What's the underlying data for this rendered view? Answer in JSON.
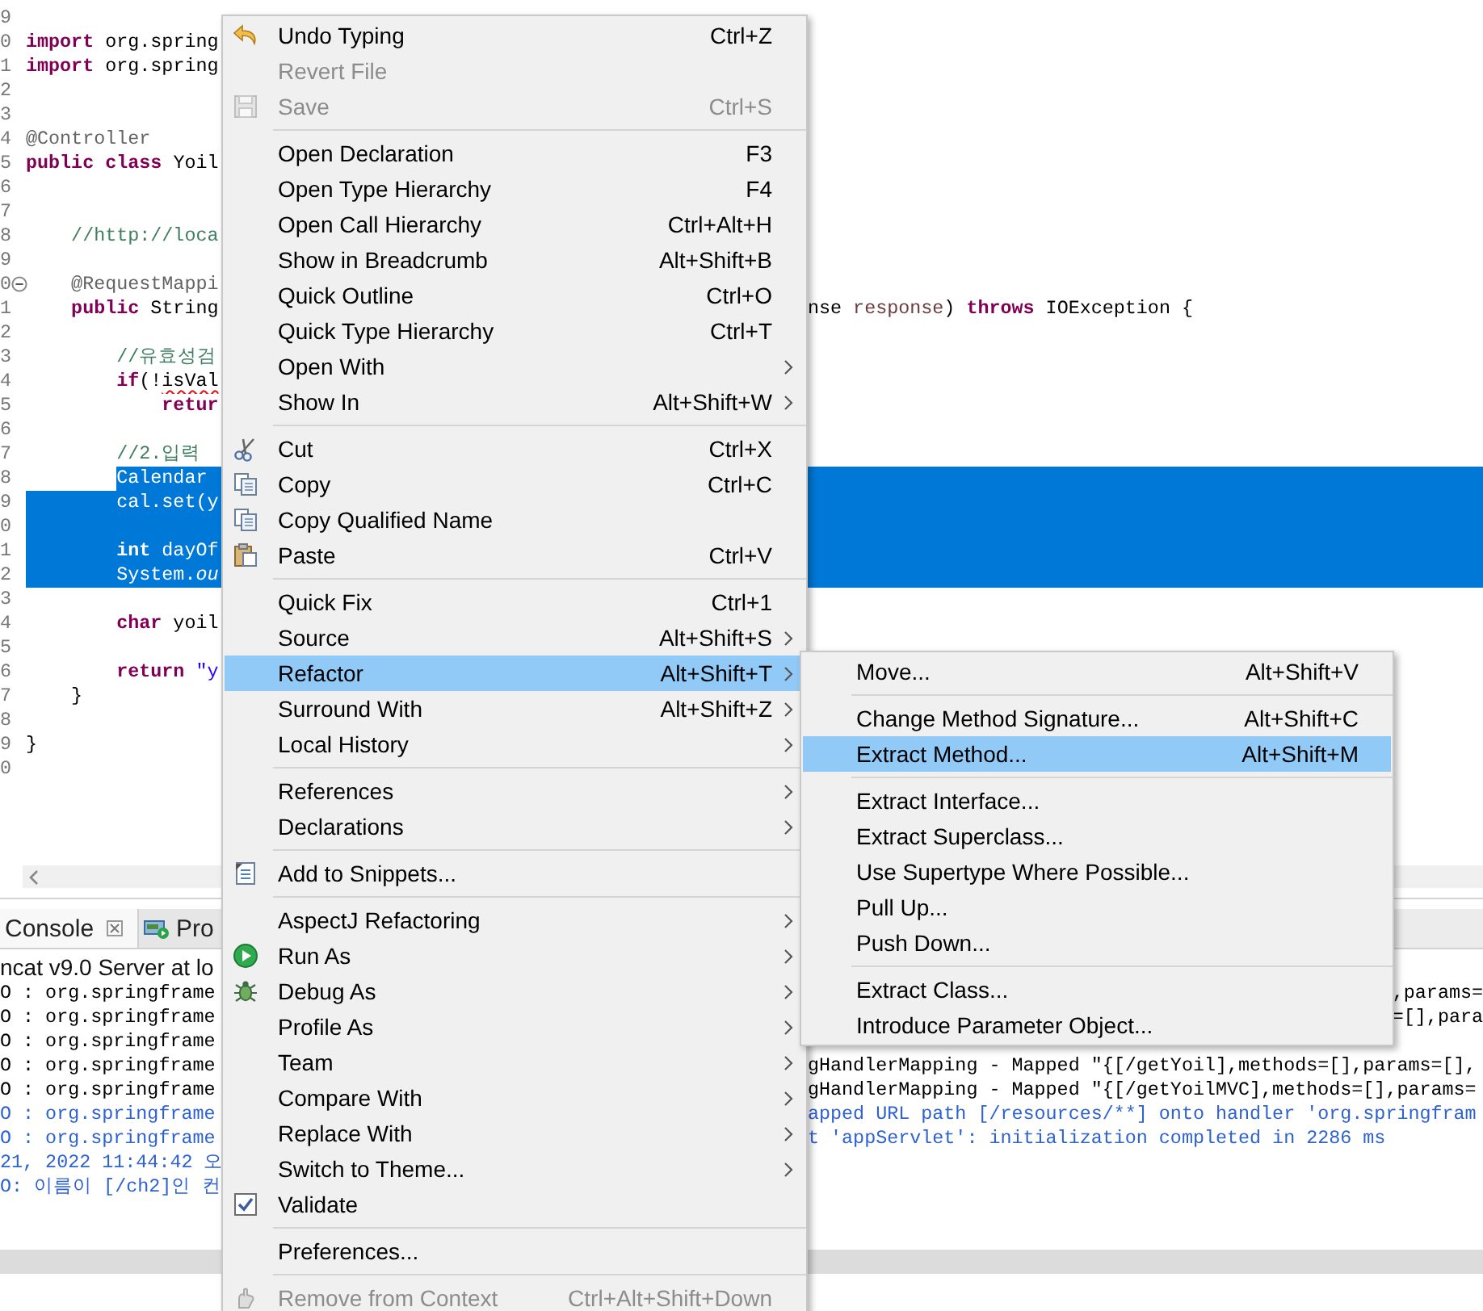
{
  "editor": {
    "lines": [
      {
        "number": "9",
        "selected": false,
        "fold": false
      },
      {
        "number": "0",
        "tokens": [
          {
            "kind": "keyword",
            "text": "import"
          },
          {
            "kind": "plain",
            "text": " org.spring"
          }
        ],
        "selected": false,
        "fold": false
      },
      {
        "number": "1",
        "tokens": [
          {
            "kind": "keyword",
            "text": "import"
          },
          {
            "kind": "plain",
            "text": " org.spring"
          }
        ],
        "selected": false,
        "fold": false
      },
      {
        "number": "2",
        "selected": false,
        "fold": false
      },
      {
        "number": "3",
        "selected": false,
        "fold": false
      },
      {
        "number": "4",
        "tokens": [
          {
            "kind": "annotation",
            "text": "@Controller"
          }
        ],
        "selected": false,
        "fold": false
      },
      {
        "number": "5",
        "tokens": [
          {
            "kind": "keyword",
            "text": "public"
          },
          {
            "kind": "keyword",
            "text": " class"
          },
          {
            "kind": "plain",
            "text": " Yoil"
          }
        ],
        "selected": false,
        "fold": false
      },
      {
        "number": "6",
        "selected": false,
        "fold": false
      },
      {
        "number": "7",
        "selected": false,
        "fold": false
      },
      {
        "number": "8",
        "tokens": [
          {
            "kind": "comment",
            "text": "    //http://loca"
          }
        ],
        "selected": false,
        "fold": false
      },
      {
        "number": "9",
        "selected": false,
        "fold": false
      },
      {
        "number": "0",
        "tokens": [
          {
            "kind": "annotation",
            "text": "    @RequestMappi"
          }
        ],
        "selected": false,
        "fold": true
      },
      {
        "number": "1",
        "tokens": [
          {
            "kind": "keyword",
            "text": "    public"
          },
          {
            "kind": "plain",
            "text": " String"
          }
        ],
        "right_tokens": [
          {
            "kind": "plain",
            "text": "nse"
          },
          {
            "kind": "variable",
            "text": " response"
          },
          {
            "kind": "plain",
            "text": ")"
          },
          {
            "kind": "keyword",
            "text": " throws"
          },
          {
            "kind": "plain",
            "text": " IOException {"
          }
        ],
        "selected": false,
        "fold": false
      },
      {
        "number": "2",
        "selected": false,
        "fold": false
      },
      {
        "number": "3",
        "tokens": [
          {
            "kind": "comment",
            "text": "        //유효성검"
          }
        ],
        "selected": false,
        "fold": false
      },
      {
        "number": "4",
        "tokens": [
          {
            "kind": "keyword",
            "text": "        if"
          },
          {
            "kind": "plain",
            "text": "(!"
          },
          {
            "kind": "error",
            "text": "isVal"
          }
        ],
        "selected": false,
        "fold": false
      },
      {
        "number": "5",
        "tokens": [
          {
            "kind": "keyword",
            "text": "            retur"
          }
        ],
        "selected": false,
        "fold": false
      },
      {
        "number": "6",
        "selected": false,
        "fold": false
      },
      {
        "number": "7",
        "tokens": [
          {
            "kind": "comment",
            "text": "        //2.입력"
          }
        ],
        "selected": false,
        "fold": false
      },
      {
        "number": "8",
        "tokens": [
          {
            "kind": "plain",
            "text": "        Calendar"
          }
        ],
        "selected": true,
        "fold": false
      },
      {
        "number": "9",
        "tokens": [
          {
            "kind": "plain",
            "text": "        cal.set(y"
          }
        ],
        "selected": true,
        "fold": false
      },
      {
        "number": "0",
        "selected": true,
        "fold": false
      },
      {
        "number": "1",
        "tokens": [
          {
            "kind": "keyword",
            "text": "        int"
          },
          {
            "kind": "plain",
            "text": " dayOf"
          }
        ],
        "selected": true,
        "fold": false
      },
      {
        "number": "2",
        "tokens": [
          {
            "kind": "plain",
            "text": "        System."
          },
          {
            "kind": "field",
            "text": "ou"
          }
        ],
        "selected": true,
        "fold": false
      },
      {
        "number": "3",
        "selected": false,
        "fold": false
      },
      {
        "number": "4",
        "tokens": [
          {
            "kind": "keyword",
            "text": "        char"
          },
          {
            "kind": "plain",
            "text": " yoil"
          }
        ],
        "selected": false,
        "fold": false
      },
      {
        "number": "5",
        "selected": false,
        "fold": false
      },
      {
        "number": "6",
        "tokens": [
          {
            "kind": "keyword",
            "text": "        return"
          },
          {
            "kind": "string",
            "text": " \"y"
          }
        ],
        "selected": false,
        "fold": false
      },
      {
        "number": "7",
        "tokens": [
          {
            "kind": "plain",
            "text": "    }"
          }
        ],
        "selected": false,
        "fold": false
      },
      {
        "number": "8",
        "selected": false,
        "fold": false
      },
      {
        "number": "9",
        "tokens": [
          {
            "kind": "plain",
            "text": "}"
          }
        ],
        "selected": false,
        "fold": false
      },
      {
        "number": "0",
        "selected": false,
        "fold": false
      }
    ]
  },
  "panel": {
    "tabs": [
      {
        "label": "Console",
        "selected": true
      },
      {
        "label": "Pro",
        "selected": false
      }
    ],
    "header": "ncat v9.0 Server at lo",
    "lines": [
      {
        "left": "O : org.springframe",
        "right": ",params=",
        "color": "#000000"
      },
      {
        "left": "O : org.springframe",
        "right": "=[],para",
        "color": "#000000"
      },
      {
        "left": "O : org.springframe",
        "color": "#000000"
      },
      {
        "left": "O : org.springframe",
        "right": "gHandlerMapping - Mapped \"{[/getYoil],methods=[],params=[],",
        "color": "#000000"
      },
      {
        "left": "O : org.springframe",
        "right": "gHandlerMapping - Mapped \"{[/getYoilMVC],methods=[],params=",
        "color": "#000000"
      },
      {
        "left": "O : org.springframe",
        "right": "apped URL path [/resources/**] onto handler 'org.springfram",
        "color": "#2e62d0"
      },
      {
        "left": "O : org.springframe",
        "right": "t 'appServlet': initialization completed in 2286 ms",
        "color": "#2e62d0"
      },
      {
        "left": "21, 2022 11:44:42 오",
        "color": "#2e62d0"
      },
      {
        "left": "O: 이름이 [/ch2]인 컨",
        "color": "#2e62d0"
      }
    ]
  },
  "menu": {
    "items": [
      {
        "kind": "item",
        "label": "Undo Typing",
        "shortcut": "Ctrl+Z",
        "submenu": false,
        "disabled": false,
        "selected": false
      },
      {
        "kind": "item",
        "label": "Revert File",
        "submenu": false,
        "disabled": true,
        "selected": false
      },
      {
        "kind": "item",
        "label": "Save",
        "shortcut": "Ctrl+S",
        "submenu": false,
        "disabled": true,
        "selected": false
      },
      {
        "kind": "separator"
      },
      {
        "kind": "item",
        "label": "Open Declaration",
        "shortcut": "F3",
        "submenu": false,
        "disabled": false,
        "selected": false
      },
      {
        "kind": "item",
        "label": "Open Type Hierarchy",
        "shortcut": "F4",
        "submenu": false,
        "disabled": false,
        "selected": false
      },
      {
        "kind": "item",
        "label": "Open Call Hierarchy",
        "shortcut": "Ctrl+Alt+H",
        "submenu": false,
        "disabled": false,
        "selected": false
      },
      {
        "kind": "item",
        "label": "Show in Breadcrumb",
        "shortcut": "Alt+Shift+B",
        "submenu": false,
        "disabled": false,
        "selected": false
      },
      {
        "kind": "item",
        "label": "Quick Outline",
        "shortcut": "Ctrl+O",
        "submenu": false,
        "disabled": false,
        "selected": false
      },
      {
        "kind": "item",
        "label": "Quick Type Hierarchy",
        "shortcut": "Ctrl+T",
        "submenu": false,
        "disabled": false,
        "selected": false
      },
      {
        "kind": "item",
        "label": "Open With",
        "submenu": true,
        "disabled": false,
        "selected": false
      },
      {
        "kind": "item",
        "label": "Show In",
        "shortcut": "Alt+Shift+W",
        "submenu": true,
        "disabled": false,
        "selected": false
      },
      {
        "kind": "separator"
      },
      {
        "kind": "item",
        "label": "Cut",
        "shortcut": "Ctrl+X",
        "submenu": false,
        "disabled": false,
        "selected": false
      },
      {
        "kind": "item",
        "label": "Copy",
        "shortcut": "Ctrl+C",
        "submenu": false,
        "disabled": false,
        "selected": false
      },
      {
        "kind": "item",
        "label": "Copy Qualified Name",
        "submenu": false,
        "disabled": false,
        "selected": false
      },
      {
        "kind": "item",
        "label": "Paste",
        "shortcut": "Ctrl+V",
        "submenu": false,
        "disabled": false,
        "selected": false
      },
      {
        "kind": "separator"
      },
      {
        "kind": "item",
        "label": "Quick Fix",
        "shortcut": "Ctrl+1",
        "submenu": false,
        "disabled": false,
        "selected": false
      },
      {
        "kind": "item",
        "label": "Source",
        "shortcut": "Alt+Shift+S",
        "submenu": true,
        "disabled": false,
        "selected": false
      },
      {
        "kind": "item",
        "label": "Refactor",
        "shortcut": "Alt+Shift+T",
        "submenu": true,
        "disabled": false,
        "selected": true
      },
      {
        "kind": "item",
        "label": "Surround With",
        "shortcut": "Alt+Shift+Z",
        "submenu": true,
        "disabled": false,
        "selected": false
      },
      {
        "kind": "item",
        "label": "Local History",
        "submenu": true,
        "disabled": false,
        "selected": false
      },
      {
        "kind": "separator"
      },
      {
        "kind": "item",
        "label": "References",
        "submenu": true,
        "disabled": false,
        "selected": false
      },
      {
        "kind": "item",
        "label": "Declarations",
        "submenu": true,
        "disabled": false,
        "selected": false
      },
      {
        "kind": "separator"
      },
      {
        "kind": "item",
        "label": "Add to Snippets...",
        "submenu": false,
        "disabled": false,
        "selected": false
      },
      {
        "kind": "separator"
      },
      {
        "kind": "item",
        "label": "AspectJ Refactoring",
        "submenu": true,
        "disabled": false,
        "selected": false
      },
      {
        "kind": "item",
        "label": "Run As",
        "submenu": true,
        "disabled": false,
        "selected": false
      },
      {
        "kind": "item",
        "label": "Debug As",
        "submenu": true,
        "disabled": false,
        "selected": false
      },
      {
        "kind": "item",
        "label": "Profile As",
        "submenu": true,
        "disabled": false,
        "selected": false
      },
      {
        "kind": "item",
        "label": "Team",
        "submenu": true,
        "disabled": false,
        "selected": false
      },
      {
        "kind": "item",
        "label": "Compare With",
        "submenu": true,
        "disabled": false,
        "selected": false
      },
      {
        "kind": "item",
        "label": "Replace With",
        "submenu": true,
        "disabled": false,
        "selected": false
      },
      {
        "kind": "item",
        "label": "Switch to Theme...",
        "submenu": true,
        "disabled": false,
        "selected": false
      },
      {
        "kind": "check",
        "label": "Validate",
        "checked": true,
        "submenu": false,
        "disabled": false,
        "selected": false
      },
      {
        "kind": "separator"
      },
      {
        "kind": "item",
        "label": "Preferences...",
        "submenu": false,
        "disabled": false,
        "selected": false
      },
      {
        "kind": "separator"
      },
      {
        "kind": "item",
        "label": "Remove from Context",
        "shortcut": "Ctrl+Alt+Shift+Down",
        "submenu": false,
        "disabled": true,
        "selected": false
      }
    ]
  },
  "submenu": {
    "items": [
      {
        "kind": "item",
        "label": "Move...",
        "shortcut": "Alt+Shift+V",
        "selected": false
      },
      {
        "kind": "separator"
      },
      {
        "kind": "item",
        "label": "Change Method Signature...",
        "shortcut": "Alt+Shift+C",
        "selected": false
      },
      {
        "kind": "item",
        "label": "Extract Method...",
        "shortcut": "Alt+Shift+M",
        "selected": true
      },
      {
        "kind": "separator"
      },
      {
        "kind": "item",
        "label": "Extract Interface...",
        "selected": false
      },
      {
        "kind": "item",
        "label": "Extract Superclass...",
        "selected": false
      },
      {
        "kind": "item",
        "label": "Use Supertype Where Possible...",
        "selected": false
      },
      {
        "kind": "item",
        "label": "Pull Up...",
        "selected": false
      },
      {
        "kind": "item",
        "label": "Push Down...",
        "selected": false
      },
      {
        "kind": "separator"
      },
      {
        "kind": "item",
        "label": "Extract Class...",
        "selected": false
      },
      {
        "kind": "item",
        "label": "Introduce Parameter Object...",
        "selected": false
      }
    ]
  }
}
